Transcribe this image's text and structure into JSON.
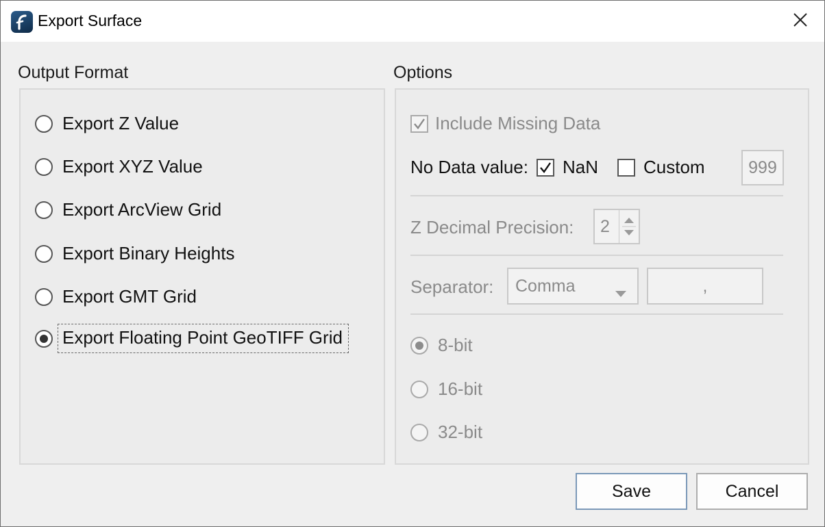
{
  "window": {
    "title": "Export Surface"
  },
  "output_format": {
    "title": "Output Format",
    "options": [
      {
        "label": "Export Z Value",
        "selected": false
      },
      {
        "label": "Export XYZ Value",
        "selected": false
      },
      {
        "label": "Export ArcView Grid",
        "selected": false
      },
      {
        "label": "Export Binary Heights",
        "selected": false
      },
      {
        "label": "Export GMT Grid",
        "selected": false
      },
      {
        "label": "Export Floating Point GeoTIFF Grid",
        "selected": true
      }
    ]
  },
  "options": {
    "title": "Options",
    "include_missing_data": {
      "label": "Include Missing Data",
      "checked": true,
      "enabled": false
    },
    "no_data": {
      "label": "No Data value:",
      "nan_label": "NaN",
      "nan_checked": true,
      "custom_label": "Custom",
      "custom_checked": false,
      "custom_value": "999"
    },
    "z_precision": {
      "label": "Z Decimal Precision:",
      "value": "2"
    },
    "separator": {
      "label": "Separator:",
      "selected": "Comma",
      "value": ","
    },
    "bit_depth": [
      {
        "label": "8-bit",
        "selected": true
      },
      {
        "label": "16-bit",
        "selected": false
      },
      {
        "label": "32-bit",
        "selected": false
      }
    ]
  },
  "buttons": {
    "save": "Save",
    "cancel": "Cancel"
  }
}
